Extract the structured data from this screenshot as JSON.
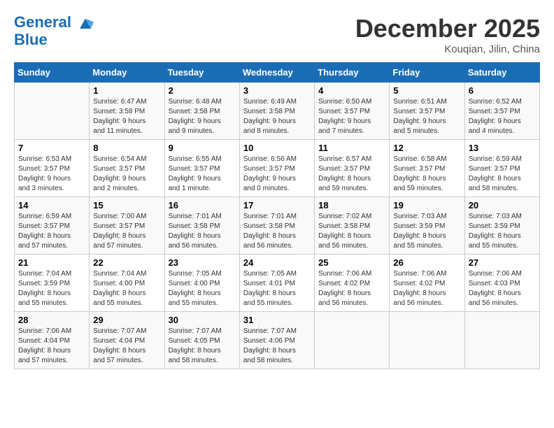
{
  "header": {
    "logo_line1": "General",
    "logo_line2": "Blue",
    "month": "December 2025",
    "location": "Kouqian, Jilin, China"
  },
  "weekdays": [
    "Sunday",
    "Monday",
    "Tuesday",
    "Wednesday",
    "Thursday",
    "Friday",
    "Saturday"
  ],
  "weeks": [
    [
      {
        "day": "",
        "info": ""
      },
      {
        "day": "1",
        "info": "Sunrise: 6:47 AM\nSunset: 3:58 PM\nDaylight: 9 hours\nand 11 minutes."
      },
      {
        "day": "2",
        "info": "Sunrise: 6:48 AM\nSunset: 3:58 PM\nDaylight: 9 hours\nand 9 minutes."
      },
      {
        "day": "3",
        "info": "Sunrise: 6:49 AM\nSunset: 3:58 PM\nDaylight: 9 hours\nand 8 minutes."
      },
      {
        "day": "4",
        "info": "Sunrise: 6:50 AM\nSunset: 3:57 PM\nDaylight: 9 hours\nand 7 minutes."
      },
      {
        "day": "5",
        "info": "Sunrise: 6:51 AM\nSunset: 3:57 PM\nDaylight: 9 hours\nand 5 minutes."
      },
      {
        "day": "6",
        "info": "Sunrise: 6:52 AM\nSunset: 3:57 PM\nDaylight: 9 hours\nand 4 minutes."
      }
    ],
    [
      {
        "day": "7",
        "info": "Sunrise: 6:53 AM\nSunset: 3:57 PM\nDaylight: 9 hours\nand 3 minutes."
      },
      {
        "day": "8",
        "info": "Sunrise: 6:54 AM\nSunset: 3:57 PM\nDaylight: 9 hours\nand 2 minutes."
      },
      {
        "day": "9",
        "info": "Sunrise: 6:55 AM\nSunset: 3:57 PM\nDaylight: 9 hours\nand 1 minute."
      },
      {
        "day": "10",
        "info": "Sunrise: 6:56 AM\nSunset: 3:57 PM\nDaylight: 9 hours\nand 0 minutes."
      },
      {
        "day": "11",
        "info": "Sunrise: 6:57 AM\nSunset: 3:57 PM\nDaylight: 8 hours\nand 59 minutes."
      },
      {
        "day": "12",
        "info": "Sunrise: 6:58 AM\nSunset: 3:57 PM\nDaylight: 8 hours\nand 59 minutes."
      },
      {
        "day": "13",
        "info": "Sunrise: 6:59 AM\nSunset: 3:57 PM\nDaylight: 8 hours\nand 58 minutes."
      }
    ],
    [
      {
        "day": "14",
        "info": "Sunrise: 6:59 AM\nSunset: 3:57 PM\nDaylight: 8 hours\nand 57 minutes."
      },
      {
        "day": "15",
        "info": "Sunrise: 7:00 AM\nSunset: 3:57 PM\nDaylight: 8 hours\nand 57 minutes."
      },
      {
        "day": "16",
        "info": "Sunrise: 7:01 AM\nSunset: 3:58 PM\nDaylight: 8 hours\nand 56 minutes."
      },
      {
        "day": "17",
        "info": "Sunrise: 7:01 AM\nSunset: 3:58 PM\nDaylight: 8 hours\nand 56 minutes."
      },
      {
        "day": "18",
        "info": "Sunrise: 7:02 AM\nSunset: 3:58 PM\nDaylight: 8 hours\nand 56 minutes."
      },
      {
        "day": "19",
        "info": "Sunrise: 7:03 AM\nSunset: 3:59 PM\nDaylight: 8 hours\nand 55 minutes."
      },
      {
        "day": "20",
        "info": "Sunrise: 7:03 AM\nSunset: 3:59 PM\nDaylight: 8 hours\nand 55 minutes."
      }
    ],
    [
      {
        "day": "21",
        "info": "Sunrise: 7:04 AM\nSunset: 3:59 PM\nDaylight: 8 hours\nand 55 minutes."
      },
      {
        "day": "22",
        "info": "Sunrise: 7:04 AM\nSunset: 4:00 PM\nDaylight: 8 hours\nand 55 minutes."
      },
      {
        "day": "23",
        "info": "Sunrise: 7:05 AM\nSunset: 4:00 PM\nDaylight: 8 hours\nand 55 minutes."
      },
      {
        "day": "24",
        "info": "Sunrise: 7:05 AM\nSunset: 4:01 PM\nDaylight: 8 hours\nand 55 minutes."
      },
      {
        "day": "25",
        "info": "Sunrise: 7:06 AM\nSunset: 4:02 PM\nDaylight: 8 hours\nand 56 minutes."
      },
      {
        "day": "26",
        "info": "Sunrise: 7:06 AM\nSunset: 4:02 PM\nDaylight: 8 hours\nand 56 minutes."
      },
      {
        "day": "27",
        "info": "Sunrise: 7:06 AM\nSunset: 4:03 PM\nDaylight: 8 hours\nand 56 minutes."
      }
    ],
    [
      {
        "day": "28",
        "info": "Sunrise: 7:06 AM\nSunset: 4:04 PM\nDaylight: 8 hours\nand 57 minutes."
      },
      {
        "day": "29",
        "info": "Sunrise: 7:07 AM\nSunset: 4:04 PM\nDaylight: 8 hours\nand 57 minutes."
      },
      {
        "day": "30",
        "info": "Sunrise: 7:07 AM\nSunset: 4:05 PM\nDaylight: 8 hours\nand 58 minutes."
      },
      {
        "day": "31",
        "info": "Sunrise: 7:07 AM\nSunset: 4:06 PM\nDaylight: 8 hours\nand 58 minutes."
      },
      {
        "day": "",
        "info": ""
      },
      {
        "day": "",
        "info": ""
      },
      {
        "day": "",
        "info": ""
      }
    ]
  ]
}
